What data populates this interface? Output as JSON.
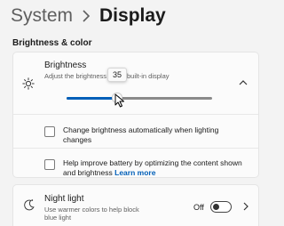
{
  "header": {
    "parent": "System",
    "current": "Display"
  },
  "section": {
    "title": "Brightness & color"
  },
  "brightness": {
    "title": "Brightness",
    "description": "Adjust the brightness of the built-in display",
    "value": 35,
    "options": [
      {
        "label": "Change brightness automatically when lighting changes",
        "checked": false
      },
      {
        "label": "Help improve battery by optimizing the content shown and brightness",
        "link": "Learn more",
        "checked": false
      }
    ]
  },
  "night_light": {
    "title": "Night light",
    "description": "Use warmer colors to help block blue light",
    "state": "Off"
  },
  "icons": [
    "chevron-right-icon",
    "sun-icon",
    "chevron-up-icon",
    "moon-icon",
    "chevron-right-icon",
    "mouse-cursor-icon"
  ],
  "colors": {
    "accent": "#005fb8",
    "background": "#f3f3f3",
    "card": "#fbfbfb"
  }
}
